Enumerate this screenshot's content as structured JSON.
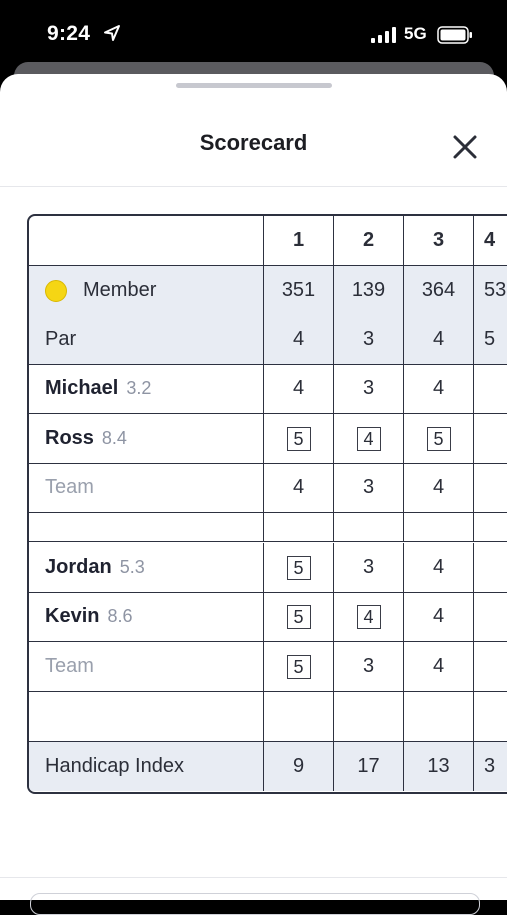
{
  "status_bar": {
    "time": "9:24",
    "network": "5G"
  },
  "sheet": {
    "title": "Scorecard"
  },
  "scorecard": {
    "holes": [
      "1",
      "2",
      "3",
      "4"
    ],
    "member_label": "Member",
    "member_yardages": [
      "351",
      "139",
      "364",
      "53"
    ],
    "par_label": "Par",
    "par": [
      "4",
      "3",
      "4",
      "5"
    ],
    "team1": {
      "players": [
        {
          "name": "Michael",
          "handicap": "3.2",
          "scores": [
            "4",
            "3",
            "4"
          ]
        },
        {
          "name": "Ross",
          "handicap": "8.4",
          "scores": [
            "5",
            "4",
            "5"
          ]
        }
      ],
      "team_label": "Team",
      "team_scores": [
        "4",
        "3",
        "4"
      ]
    },
    "team2": {
      "players": [
        {
          "name": "Jordan",
          "handicap": "5.3",
          "scores": [
            "5",
            "3",
            "4"
          ]
        },
        {
          "name": "Kevin",
          "handicap": "8.6",
          "scores": [
            "5",
            "4",
            "4"
          ]
        }
      ],
      "team_label": "Team",
      "team_scores": [
        "5",
        "3",
        "4"
      ]
    },
    "handicap_label": "Handicap Index",
    "handicap_index": [
      "9",
      "17",
      "13",
      "3"
    ]
  },
  "colors": {
    "member_dot": "#f5d614",
    "header_shade": "#e8ecf3",
    "grid": "#2d3140"
  }
}
